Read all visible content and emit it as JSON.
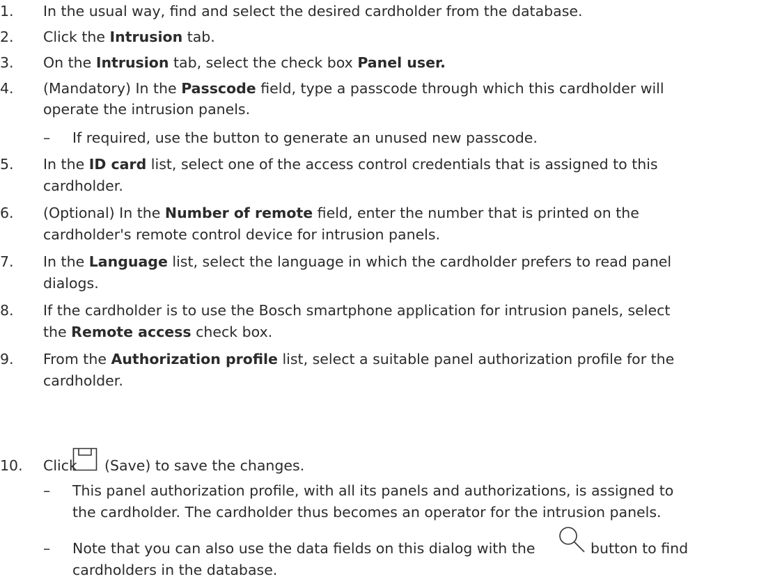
{
  "steps": {
    "s1": {
      "num": "1.",
      "t": "In the usual way, find and select the desired cardholder from the database."
    },
    "s2": {
      "num": "2.",
      "pre": "Click the ",
      "b": "Intrusion",
      "post": " tab."
    },
    "s3": {
      "num": "3.",
      "pre": "On the ",
      "b1": "Intrusion",
      "mid": " tab, select the check box ",
      "b2": "Panel user."
    },
    "s4": {
      "num": "4.",
      "pre": "(Mandatory) In the ",
      "b": "Passcode",
      "post": " field, type a passcode through which this cardholder will",
      "l2": "operate the intrusion panels.",
      "sub": "If required, use the button to generate an unused new passcode."
    },
    "s5": {
      "num": "5.",
      "pre": "In the ",
      "b": "ID card",
      "post": " list, select one of the access control credentials that is assigned to this",
      "l2": "cardholder."
    },
    "s6": {
      "num": "6.",
      "pre": "(Optional) In the ",
      "b": "Number of remote",
      "post": " field, enter the number that is printed on the",
      "l2": "cardholder's remote control device for intrusion panels."
    },
    "s7": {
      "num": "7.",
      "pre": "In the ",
      "b": "Language",
      "post": " list, select the language in which the cardholder prefers to read panel",
      "l2": "dialogs."
    },
    "s8": {
      "num": "8.",
      "t": "If the cardholder is to use the Bosch smartphone application for intrusion panels, select",
      "l2pre": "the ",
      "l2b": "Remote access",
      "l2post": " check box."
    },
    "s9": {
      "num": "9.",
      "pre": "From the ",
      "b": "Authorization profile",
      "post": " list, select a suitable panel authorization profile for the",
      "l2": "cardholder."
    },
    "s10": {
      "num": "10.",
      "pre": "Click",
      "post": "(Save) to save the changes.",
      "sub1_l1": "This panel authorization profile, with all its panels and authorizations, is assigned to",
      "sub1_l2": "the cardholder. The cardholder thus becomes an operator for the intrusion panels.",
      "sub2_pre": "Note that you can also use the data fields on this dialog with the",
      "sub2_post": "button to find",
      "sub2_l2": "cardholders in the database."
    }
  },
  "dash": "–",
  "icons": {
    "save": "floppy-disk-icon",
    "search": "magnifier-icon"
  }
}
